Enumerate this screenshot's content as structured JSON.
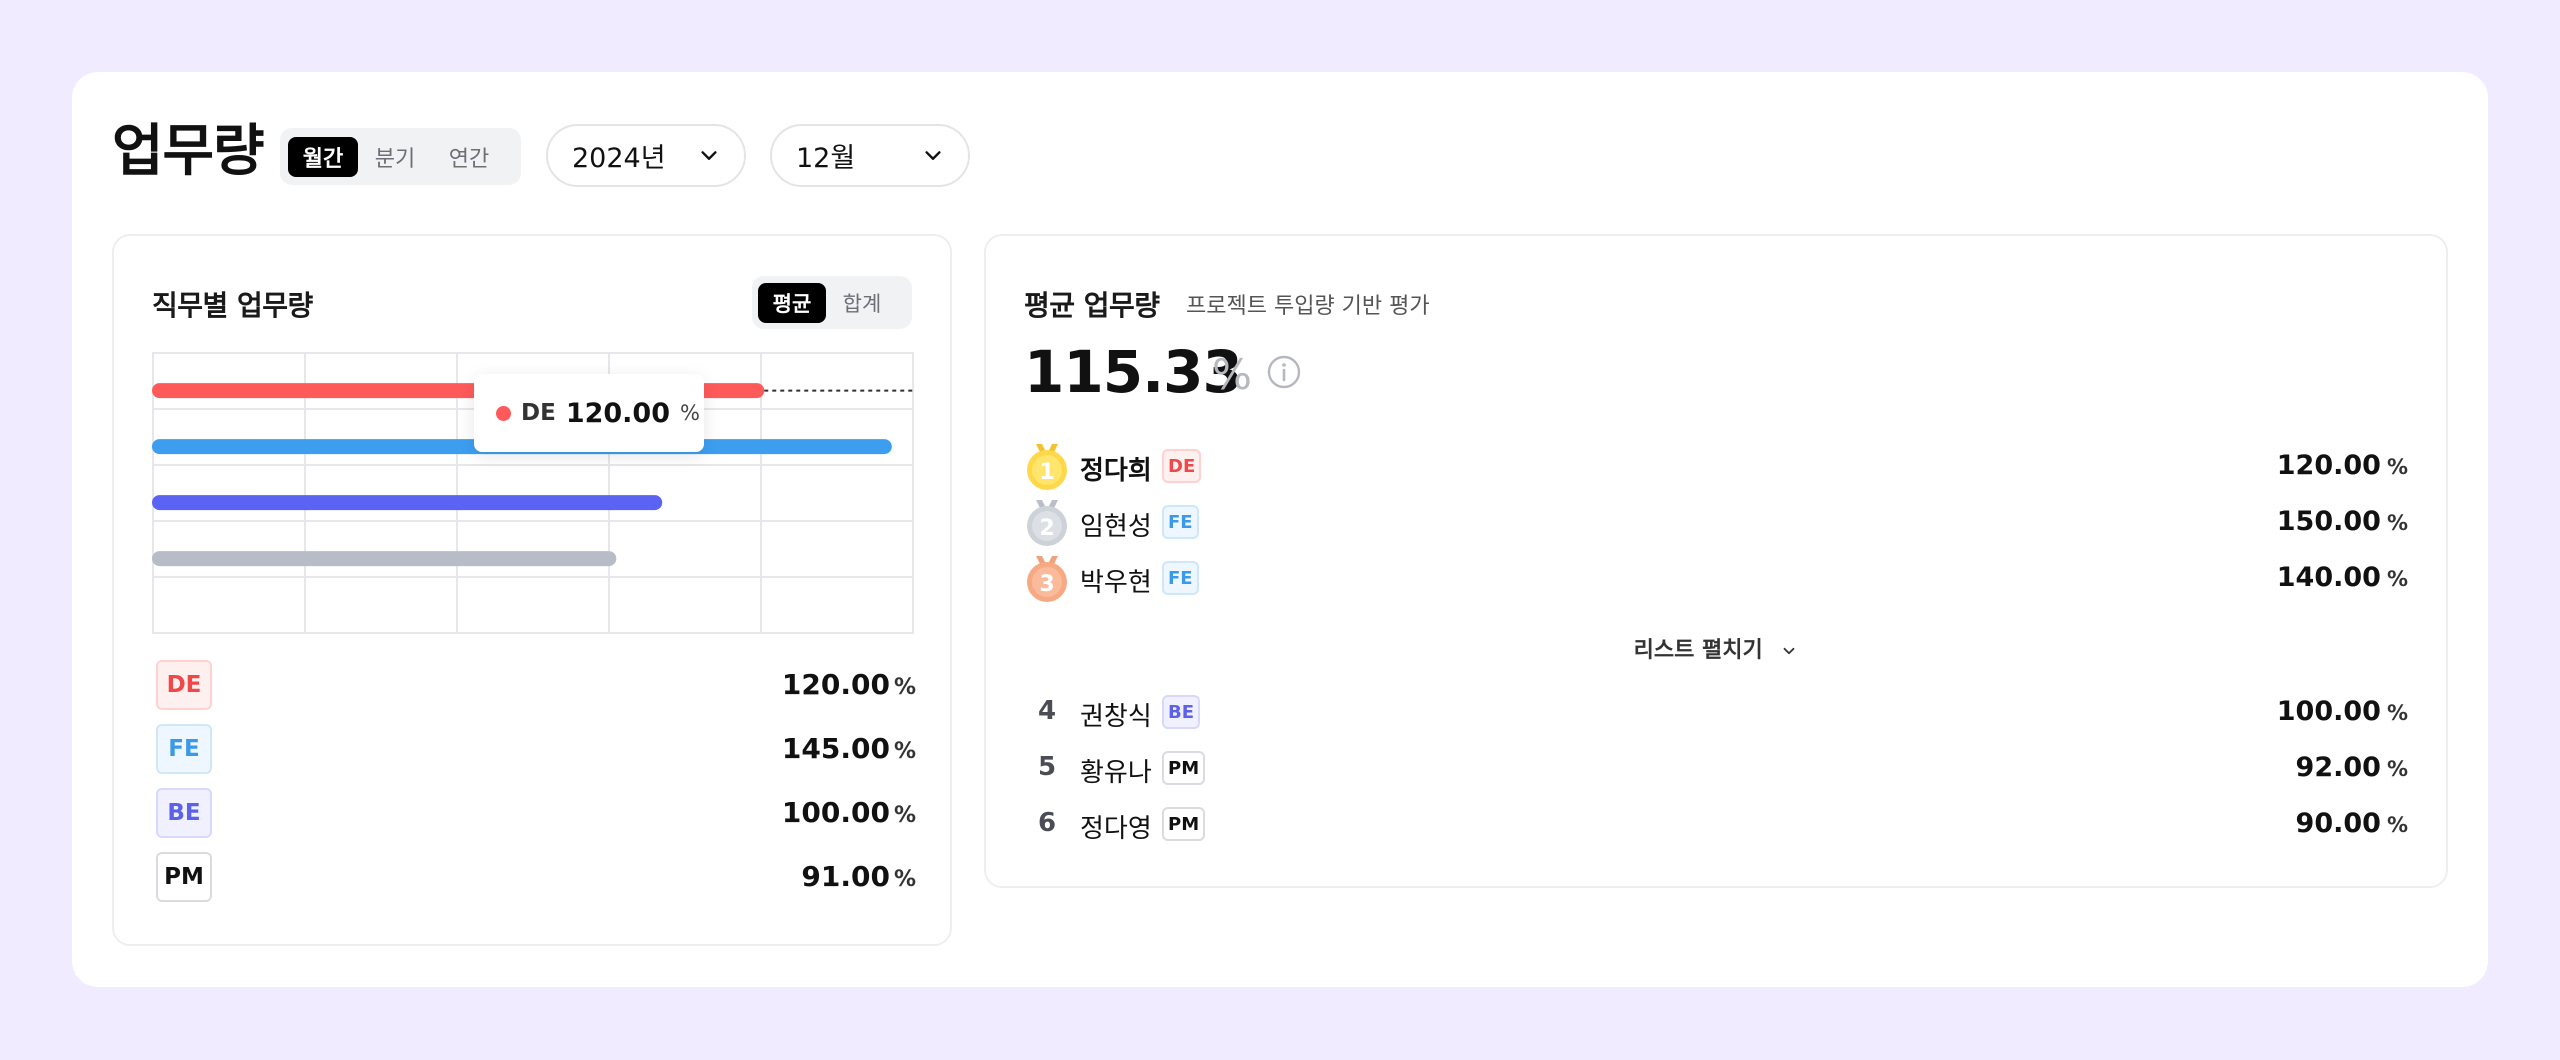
{
  "header": {
    "title": "업무량",
    "period_tabs": [
      {
        "label": "월간",
        "active": true
      },
      {
        "label": "분기",
        "active": false
      },
      {
        "label": "연간",
        "active": false
      }
    ],
    "year_select": "2024년",
    "month_select": "12월"
  },
  "left_panel": {
    "title": "직무별 업무량",
    "mode_tabs": [
      {
        "label": "평균",
        "active": true
      },
      {
        "label": "합계",
        "active": false
      }
    ],
    "tooltip": {
      "category": "DE",
      "value": "120.00",
      "unit": "%"
    },
    "legend": [
      {
        "code": "DE",
        "value": "120.00",
        "unit": "%"
      },
      {
        "code": "FE",
        "value": "145.00",
        "unit": "%"
      },
      {
        "code": "BE",
        "value": "100.00",
        "unit": "%"
      },
      {
        "code": "PM",
        "value": "91.00",
        "unit": "%"
      }
    ]
  },
  "chart_data": {
    "type": "bar",
    "orientation": "horizontal",
    "categories": [
      "DE",
      "FE",
      "BE",
      "PM"
    ],
    "values": [
      120.0,
      145.0,
      100.0,
      91.0
    ],
    "colors": [
      "#ff5a5a",
      "#3d9ef0",
      "#5b63f5",
      "#b8bcc6"
    ],
    "grid": true,
    "title": "",
    "xlabel": "",
    "ylabel": ""
  },
  "right_panel": {
    "title": "평균 업무량",
    "subtitle": "프로젝트 투입량 기반 평가",
    "average_value": "115.33",
    "average_unit": "%",
    "expand_label": "리스트 펼치기",
    "ranking": [
      {
        "rank": "1",
        "name": "정다희",
        "role": "DE",
        "value": "120.00",
        "unit": "%",
        "medal": "gold"
      },
      {
        "rank": "2",
        "name": "임현성",
        "role": "FE",
        "value": "150.00",
        "unit": "%",
        "medal": "silver"
      },
      {
        "rank": "3",
        "name": "박우현",
        "role": "FE",
        "value": "140.00",
        "unit": "%",
        "medal": "bronze"
      },
      {
        "rank": "4",
        "name": "권창식",
        "role": "BE",
        "value": "100.00",
        "unit": "%"
      },
      {
        "rank": "5",
        "name": "황유나",
        "role": "PM",
        "value": "92.00",
        "unit": "%"
      },
      {
        "rank": "6",
        "name": "정다영",
        "role": "PM",
        "value": "90.00",
        "unit": "%"
      }
    ]
  }
}
